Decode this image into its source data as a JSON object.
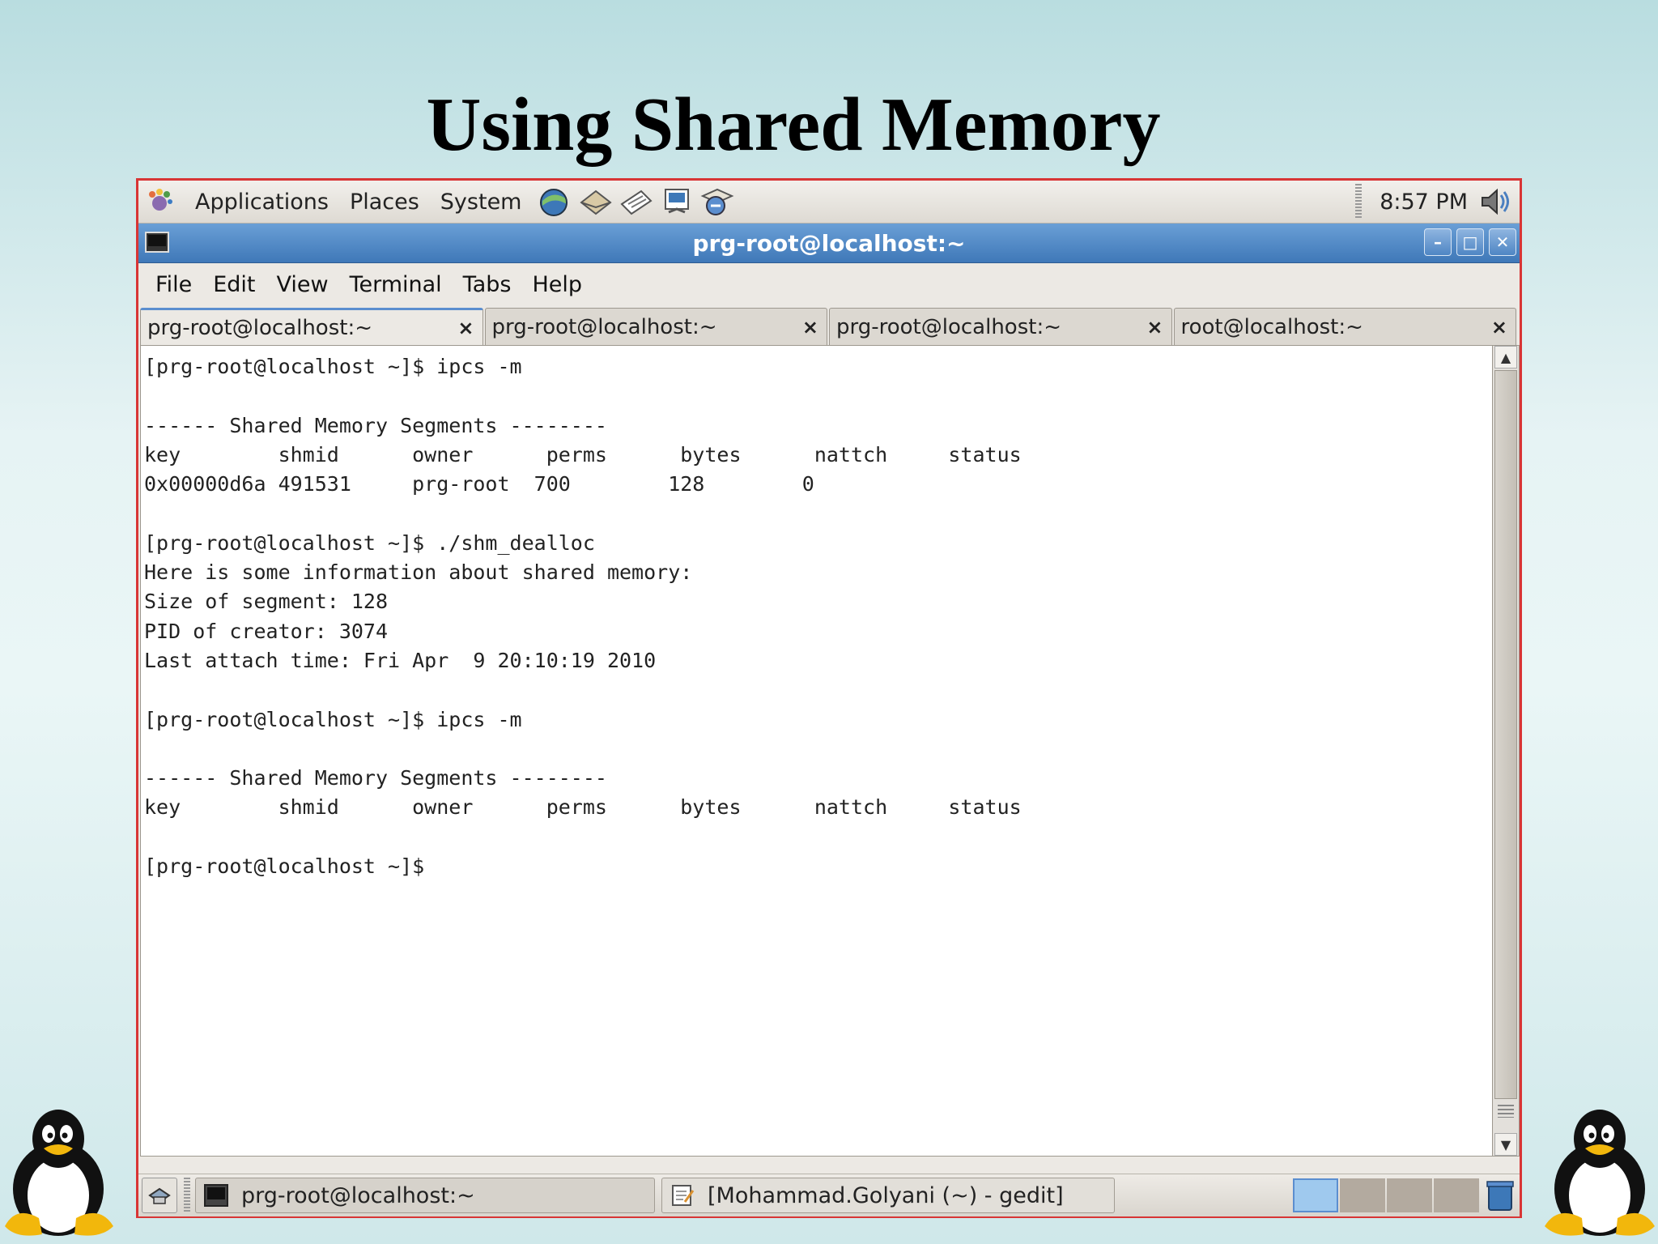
{
  "slide": {
    "title": "Using Shared Memory"
  },
  "top_panel": {
    "menus": [
      "Applications",
      "Places",
      "System"
    ],
    "launchers": [
      "web-browser-icon",
      "mail-icon",
      "notes-icon",
      "presentation-icon",
      "update-icon"
    ],
    "clock": "8:57 PM"
  },
  "window": {
    "title": "prg-root@localhost:~",
    "menubar": [
      "File",
      "Edit",
      "View",
      "Terminal",
      "Tabs",
      "Help"
    ],
    "tabs": [
      {
        "label": "prg-root@localhost:~",
        "close": "×",
        "active": true
      },
      {
        "label": "prg-root@localhost:~",
        "close": "×",
        "active": false
      },
      {
        "label": "prg-root@localhost:~",
        "close": "×",
        "active": false
      },
      {
        "label": "root@localhost:~",
        "close": "×",
        "active": false
      }
    ]
  },
  "terminal": {
    "lines": [
      "[prg-root@localhost ~]$ ipcs -m",
      "",
      "------ Shared Memory Segments --------",
      "key        shmid      owner      perms      bytes      nattch     status",
      "0x00000d6a 491531     prg-root  700        128        0",
      "",
      "[prg-root@localhost ~]$ ./shm_dealloc",
      "Here is some information about shared memory:",
      "Size of segment: 128",
      "PID of creator: 3074",
      "Last attach time: Fri Apr  9 20:10:19 2010",
      "",
      "[prg-root@localhost ~]$ ipcs -m",
      "",
      "------ Shared Memory Segments --------",
      "key        shmid      owner      perms      bytes      nattch     status",
      "",
      "[prg-root@localhost ~]$"
    ]
  },
  "bottom_panel": {
    "tasks": [
      "prg-root@localhost:~",
      "[Mohammad.Golyani (~) - gedit]"
    ],
    "workspaces": 4,
    "current_workspace": 1
  }
}
